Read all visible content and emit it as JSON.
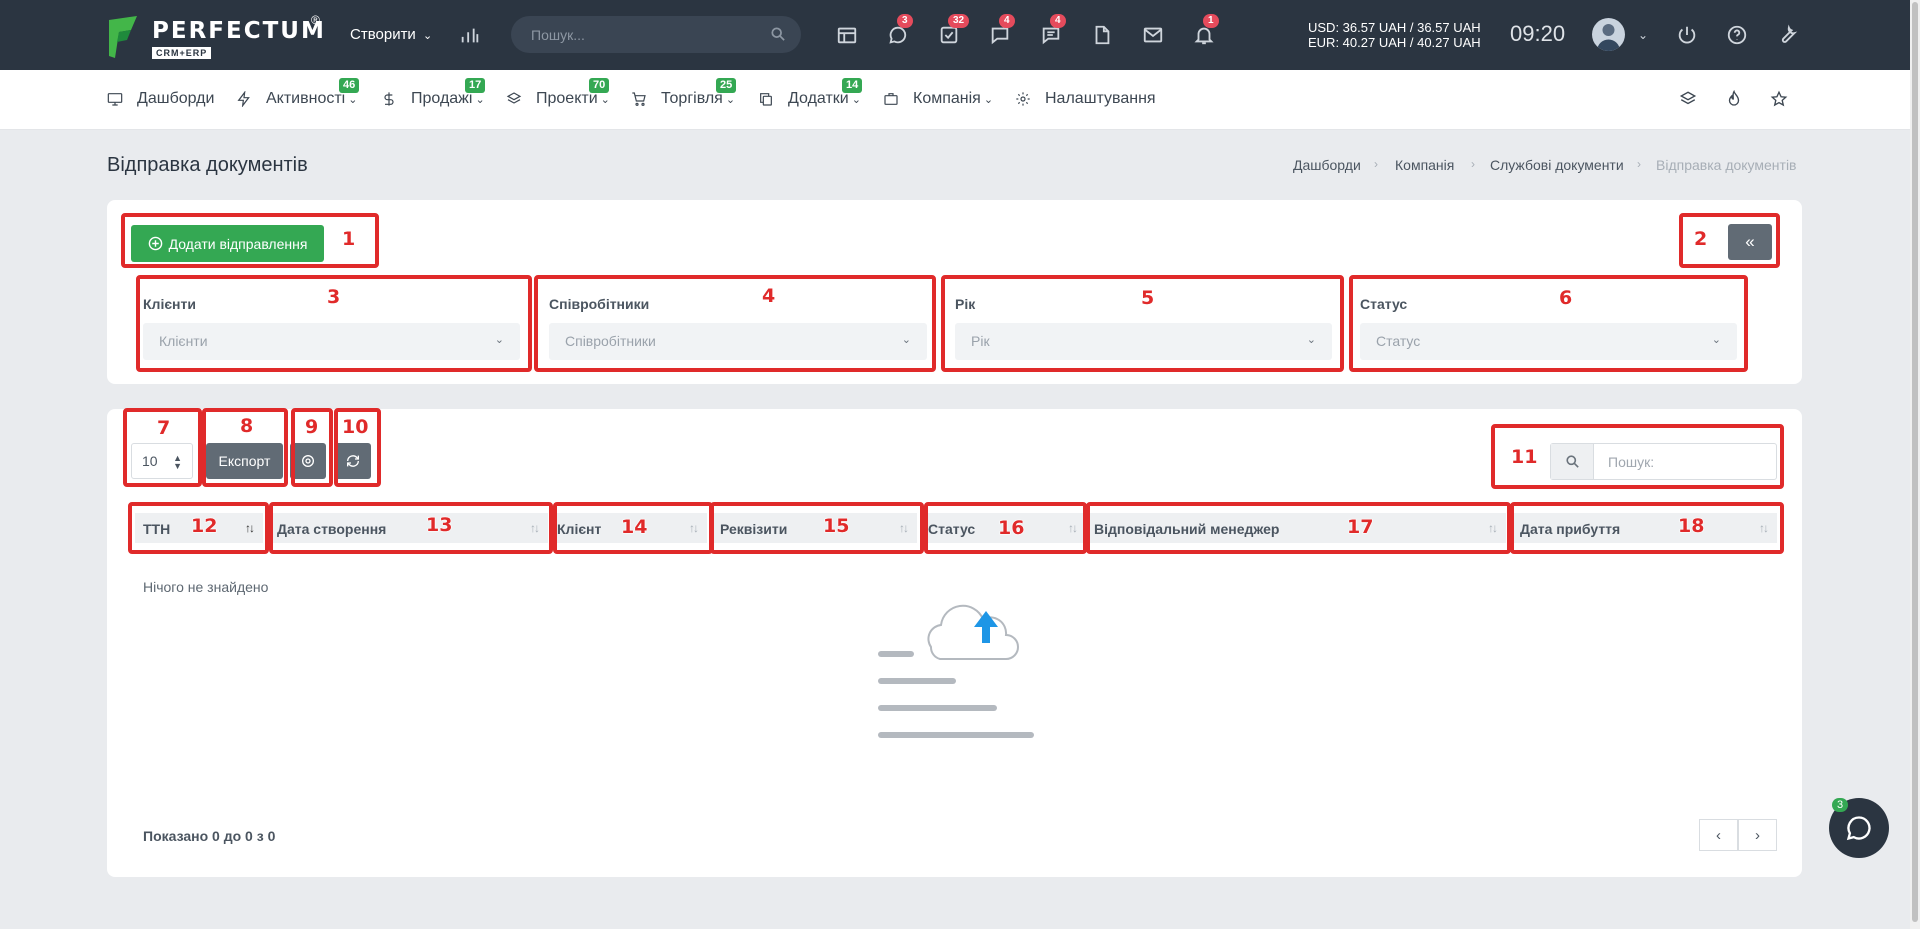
{
  "app": {
    "brand": "PERFECTUM",
    "brand_reg": "®",
    "brand_sub": "CRM+ERP",
    "create_label": "Створити",
    "search_placeholder": "Пошук...",
    "badges": {
      "chats": "3",
      "tasks": "32",
      "comments": "4",
      "messages": "4",
      "notifications": "1"
    },
    "currency_usd": "USD: 36.57 UAH / 36.57 UAH",
    "currency_eur": "EUR: 40.27 UAH / 40.27 UAH",
    "time": "09:20"
  },
  "nav": {
    "items": [
      {
        "label": "Дашборди",
        "icon": "monitor-icon"
      },
      {
        "label": "Активності",
        "badge": "46",
        "icon": "bolt-icon"
      },
      {
        "label": "Продажі",
        "badge": "17",
        "icon": "dollar-icon"
      },
      {
        "label": "Проекти",
        "badge": "70",
        "icon": "layers-icon"
      },
      {
        "label": "Торгівля",
        "badge": "25",
        "icon": "cart-icon"
      },
      {
        "label": "Додатки",
        "badge": "14",
        "icon": "copy-icon"
      },
      {
        "label": "Компанія",
        "icon": "briefcase-icon"
      },
      {
        "label": "Налаштування",
        "icon": "gear-icon"
      }
    ]
  },
  "page": {
    "title": "Відправка документів",
    "breadcrumb": [
      "Дашборди",
      "Компанія",
      "Службові документи",
      "Відправка документів"
    ]
  },
  "filters": {
    "add_label": "Додати відправлення",
    "collapse_label": "«",
    "items": [
      {
        "label": "Клієнти",
        "placeholder": "Клієнти"
      },
      {
        "label": "Співробітники",
        "placeholder": "Співробітники"
      },
      {
        "label": "Рік",
        "placeholder": "Рік"
      },
      {
        "label": "Статус",
        "placeholder": "Статус"
      }
    ]
  },
  "table": {
    "per_page": "10",
    "export_label": "Експорт",
    "search_placeholder": "Пошук:",
    "columns": [
      "ТТН",
      "Дата створення",
      "Клієнт",
      "Реквізити",
      "Статус",
      "Відповідальний менеджер",
      "Дата прибуття"
    ],
    "empty": "Нічого не знайдено",
    "shown": "Показано 0 до 0 з 0",
    "prev": "‹",
    "next": "›"
  },
  "annotations": [
    "1",
    "2",
    "3",
    "4",
    "5",
    "6",
    "7",
    "8",
    "9",
    "10",
    "11",
    "12",
    "13",
    "14",
    "15",
    "16",
    "17",
    "18"
  ],
  "chat": {
    "badge": "3"
  }
}
